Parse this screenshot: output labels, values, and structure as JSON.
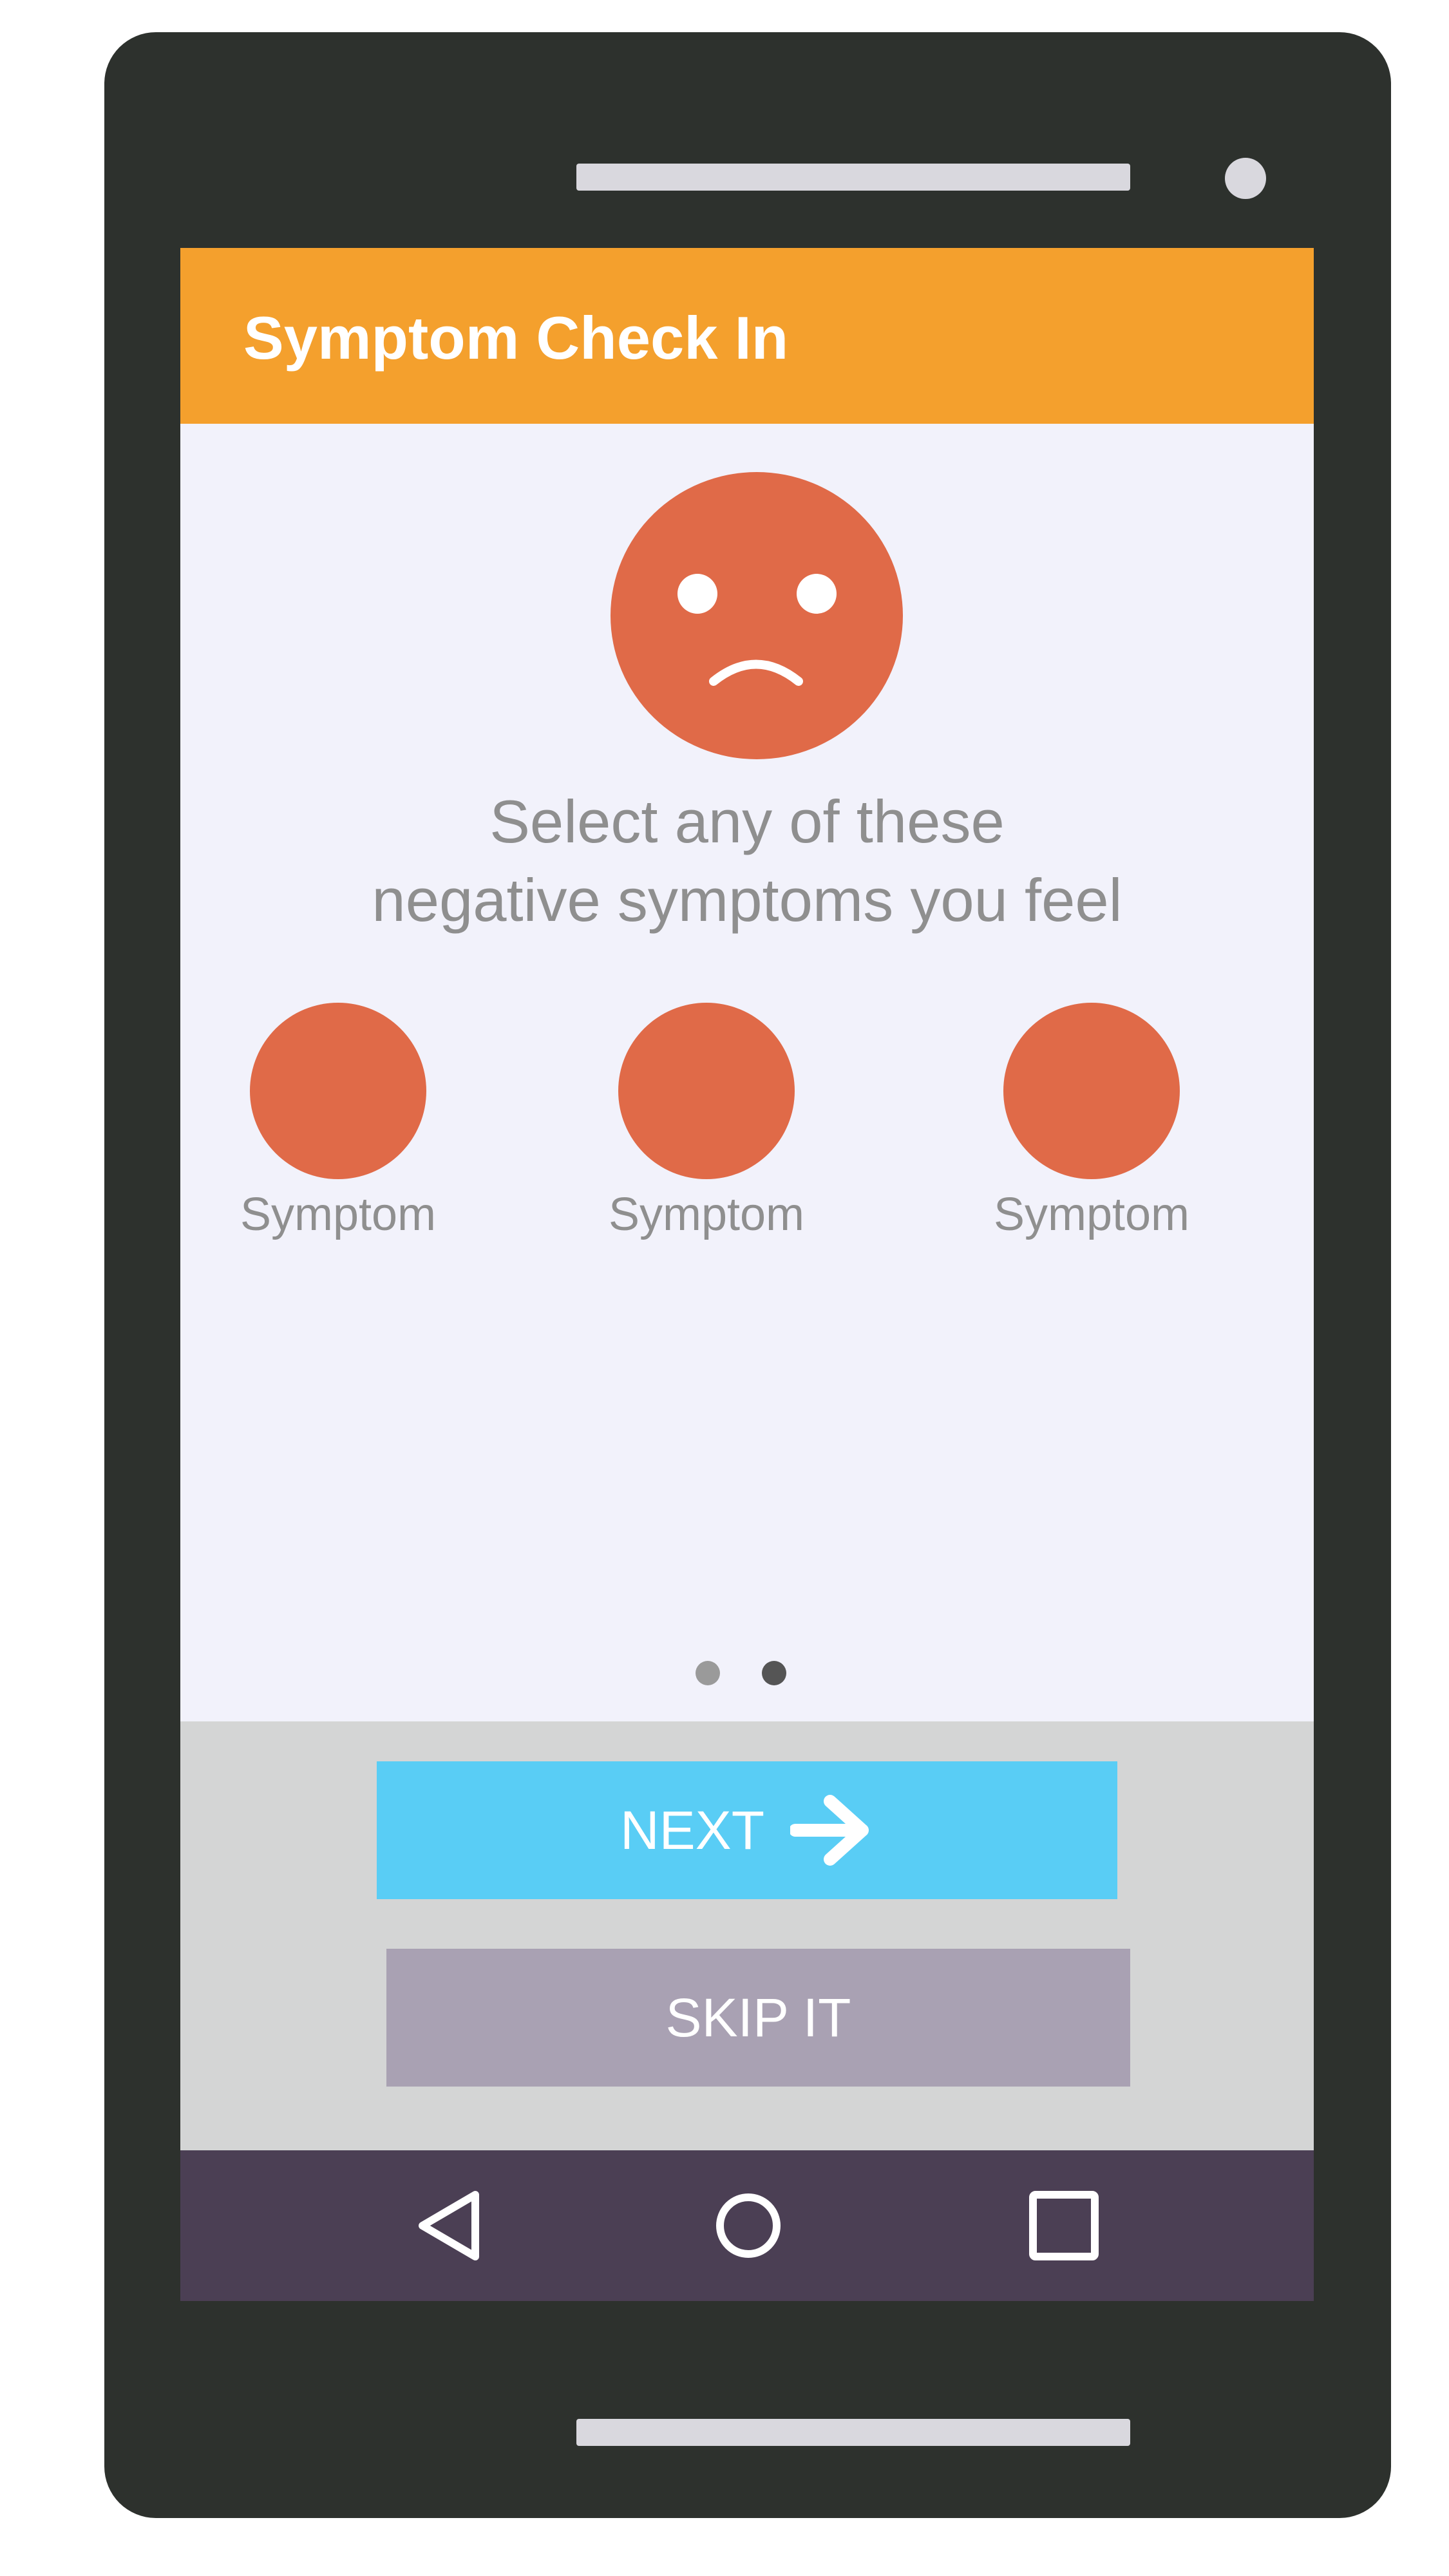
{
  "app_bar": {
    "title": "Symptom Check In"
  },
  "mood_icon": "sad-face-icon",
  "prompt": {
    "line1": "Select any of these",
    "line2": "negative symptoms you feel"
  },
  "symptoms": [
    {
      "label": "Symptom"
    },
    {
      "label": "Symptom"
    },
    {
      "label": "Symptom"
    }
  ],
  "pager": {
    "pages": 2,
    "active_page": 2
  },
  "actions": {
    "next_label": "NEXT",
    "next_icon": "arrow-right-icon",
    "skip_label": "SKIP IT"
  },
  "nav_bar": {
    "back_icon": "back-triangle-icon",
    "home_icon": "home-circle-icon",
    "recents_icon": "recents-square-icon"
  },
  "colors": {
    "app_bar": "#f4a02d",
    "accent_orange": "#e06a48",
    "next_button": "#59cdf5",
    "skip_button": "#a9a1b3",
    "nav_bar": "#4b3f54",
    "phone_body": "#2d312d",
    "screen_bg": "#f2f2fb"
  }
}
